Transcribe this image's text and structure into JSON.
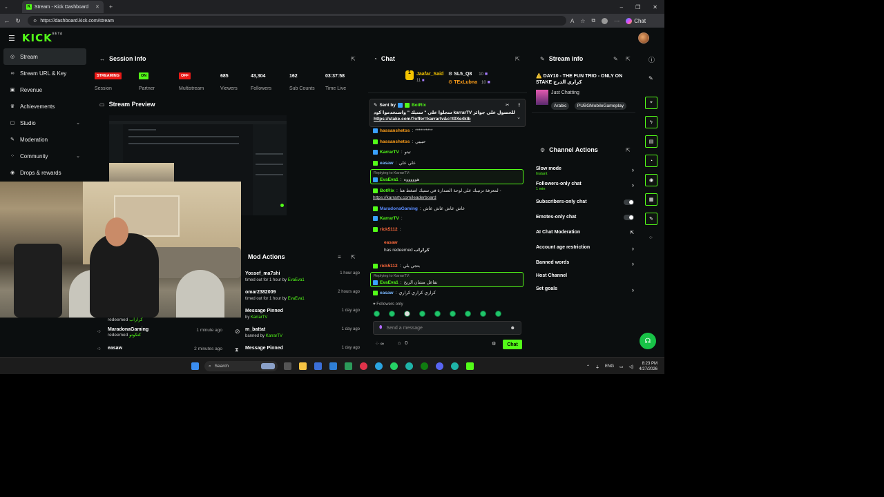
{
  "browser": {
    "tab_title": "Stream - Kick Dashboard",
    "url": "https://dashboard.kick.com/stream",
    "chat_button": "Chat"
  },
  "header": {
    "logo": "KICK",
    "logo_sup": "BETA"
  },
  "sidebar": {
    "items": [
      {
        "label": "Stream",
        "icon": "broadcast-icon",
        "active": true
      },
      {
        "label": "Stream URL & Key",
        "icon": "link-icon"
      },
      {
        "label": "Revenue",
        "icon": "revenue-icon"
      },
      {
        "label": "Achievements",
        "icon": "trophy-icon"
      },
      {
        "label": "Studio",
        "icon": "studio-icon",
        "expandable": true
      },
      {
        "label": "Moderation",
        "icon": "wrench-icon"
      },
      {
        "label": "Community",
        "icon": "community-icon",
        "expandable": true
      },
      {
        "label": "Drops & rewards",
        "icon": "drops-icon"
      }
    ]
  },
  "session": {
    "title": "Session Info",
    "stats": [
      {
        "value": "STREAMING",
        "label": "Session",
        "kind": "red"
      },
      {
        "value": "ON",
        "label": "Partner",
        "kind": "green"
      },
      {
        "value": "OFF",
        "label": "Multistream",
        "kind": "red"
      },
      {
        "value": "685",
        "label": "Viewers"
      },
      {
        "value": "43,304",
        "label": "Followers"
      },
      {
        "value": "162",
        "label": "Sub Counts"
      },
      {
        "value": "03:37:58",
        "label": "Time Live"
      }
    ]
  },
  "preview": {
    "title": "Stream Preview"
  },
  "activity_feed": [
    {
      "name": "",
      "action": "redeemed",
      "extra": "كراراب",
      "time": ""
    },
    {
      "name": "MaradonaGaming",
      "action": "redeemed",
      "extra": "كتكوتو",
      "time": "1 minute ago"
    },
    {
      "name": "easaw",
      "action": "",
      "extra": "",
      "time": "2 minutes ago"
    }
  ],
  "mod_actions": {
    "title": "Mod Actions",
    "rows": [
      {
        "name": "Yossef_ma7shi",
        "desc": "timed out for 1 hour by",
        "by": "EvaEva1",
        "time": "1 hour ago"
      },
      {
        "name": "omar2382009",
        "desc": "timed out for 1 hour by",
        "by": "EvaEva1",
        "time": "2 hours ago"
      },
      {
        "name": "Message Pinned",
        "desc": "by",
        "by": "KarrarTV",
        "time": "1 day ago"
      },
      {
        "name": "m_battat",
        "desc": "banned by",
        "by": "KarrarTV",
        "time": "1 day ago"
      },
      {
        "name": "Message Pinned",
        "desc": "",
        "by": "",
        "time": "1 day ago"
      }
    ]
  },
  "chat": {
    "title": "Chat",
    "top_gifters": [
      {
        "name": "Jaafar_Said",
        "count": "11"
      },
      {
        "name": "SL5_Q8",
        "count": "10"
      },
      {
        "name": "TExLubna",
        "count": "10"
      }
    ],
    "pinned": {
      "sent_by_label": "Sent by",
      "sent_by": "BotRix",
      "text": "للحصول على جوائز karrarTV سجلوا على \" ستيك \" واستخدموا كود",
      "link": "https://stake.com/?offer=karrartv&c=t0Xe4klb"
    },
    "messages": [
      {
        "user": "hassanshetos",
        "text": "**********",
        "color": "#ff9f1a"
      },
      {
        "user": "hassanshetos",
        "text": "حبيبي",
        "color": "#ff9f1a"
      },
      {
        "user": "KarrarTV",
        "text": "تيتو",
        "color": "#53fc18"
      },
      {
        "user": "easaw",
        "text": "علي علي",
        "color": "#7ab8ff"
      },
      {
        "user": "EvaEva1",
        "text": "هوووووه",
        "color": "#53fc18",
        "reply_to": "Replying to KarrarTV:"
      },
      {
        "user": "BotRix",
        "text": "لمعرفة ترتيبك على لوحة الصدارة في ستيك اضغط هنا -",
        "color": "#53fc18"
      },
      {
        "user": "",
        "text": "https://karrartv.com/leaderboard",
        "color": "#fff"
      },
      {
        "user": "MaradonaGaming",
        "text": "عاش عاش عاش عاش",
        "color": "#5a8bff"
      },
      {
        "user": "KarrarTV",
        "text": "",
        "color": "#53fc18"
      },
      {
        "user": "rick5112",
        "text": "",
        "color": "#ff6a3d"
      },
      {
        "user": "easaw",
        "text": "has redeemed",
        "extra": "كراراب",
        "color": "#ff6a3d"
      },
      {
        "user": "rick5112",
        "text": "بتجي بلي",
        "color": "#ff6a3d"
      },
      {
        "user": "EvaEva1",
        "text": "تفاعل مشان الربح",
        "color": "#53fc18",
        "reply_to": "Replying to KarrarTV:"
      },
      {
        "user": "easaw",
        "text": "كراري كراري كراري",
        "color": "#7ab8ff"
      }
    ],
    "followers_only": "Followers only",
    "input_placeholder": "Send a message",
    "count": "0",
    "send_label": "Chat"
  },
  "stream_info": {
    "title": "Stream info",
    "stream_title": "⚠️ DAY10 - THE FUN TRIO - ONLY ON STAKE كراري الدرج",
    "category": "Just Chatting",
    "tags": [
      "Arabic",
      "PUBGMobileGameplay"
    ]
  },
  "channel_actions": {
    "title": "Channel Actions",
    "items": [
      {
        "label": "Slow mode",
        "sub": "Instant",
        "control": "chevron"
      },
      {
        "label": "Followers-only chat",
        "sub": "1 min",
        "control": "chevron"
      },
      {
        "label": "Subscribers-only chat",
        "sub": "",
        "control": "toggle"
      },
      {
        "label": "Emotes-only chat",
        "sub": "",
        "control": "toggle"
      },
      {
        "label": "AI Chat Moderation",
        "sub": "",
        "control": "external"
      },
      {
        "label": "Account age restriction",
        "sub": "",
        "control": "chevron"
      },
      {
        "label": "Banned words",
        "sub": "",
        "control": "chevron"
      },
      {
        "label": "Host Channel",
        "sub": "",
        "control": "none"
      },
      {
        "label": "Set goals",
        "sub": "",
        "control": "chevron"
      }
    ]
  },
  "taskbar": {
    "search": "Search",
    "lang": "ENG",
    "time": "8:23 PM",
    "date": "4/27/2026"
  }
}
